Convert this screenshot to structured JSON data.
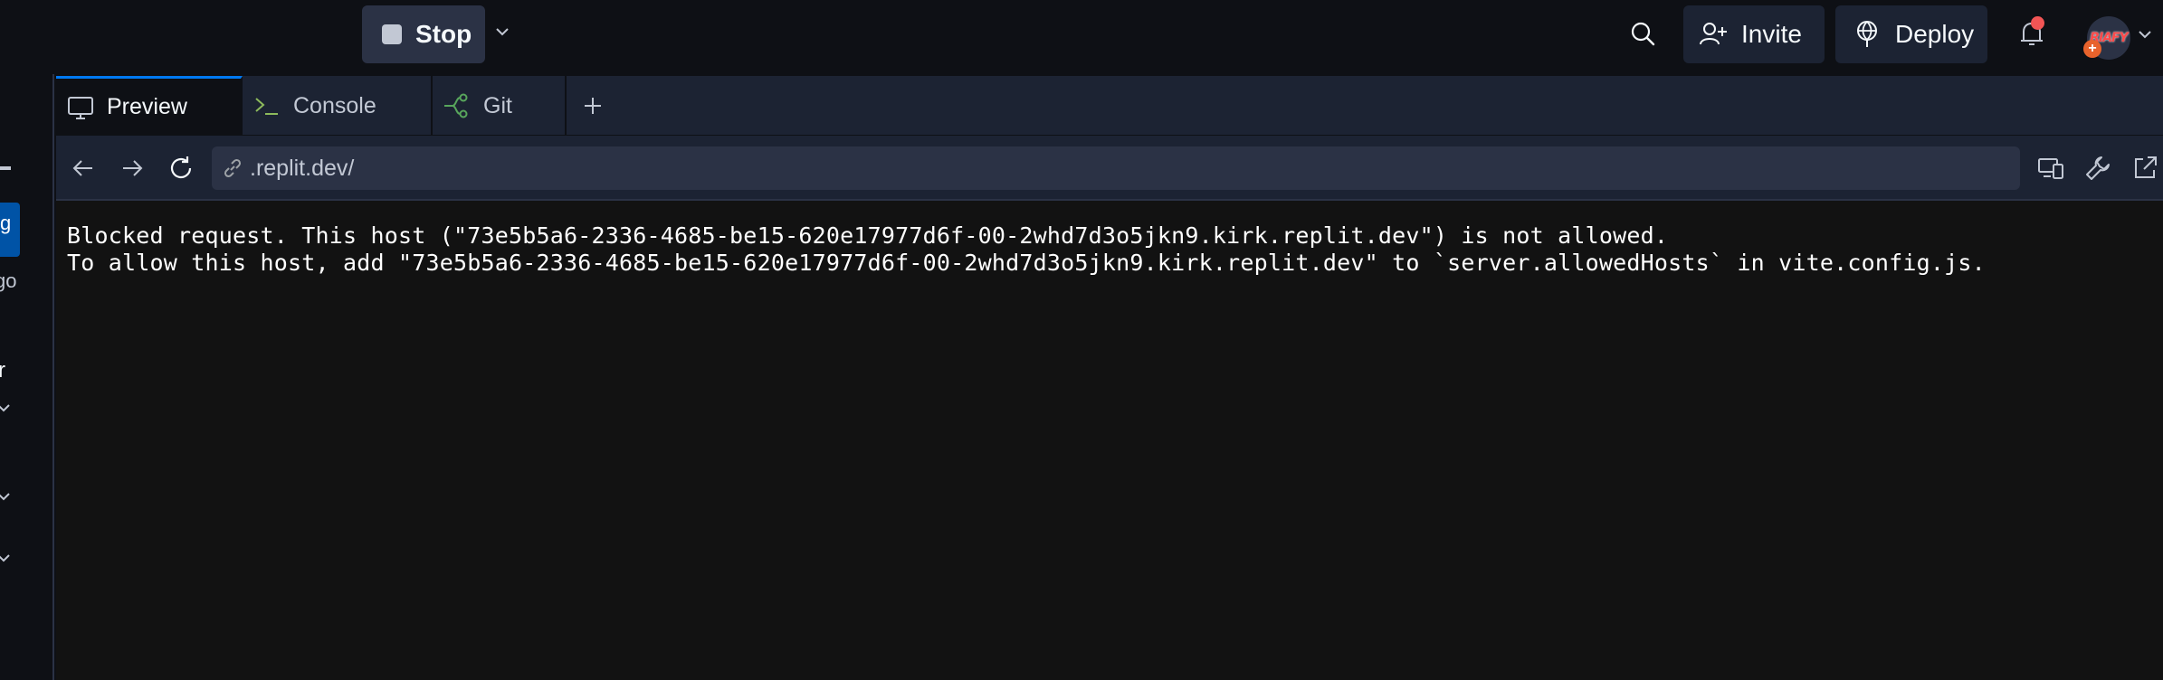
{
  "topbar": {
    "stop_label": "Stop",
    "invite_label": "Invite",
    "deploy_label": "Deploy",
    "avatar_text": "RIAFY",
    "notification_dot_color": "#f25555"
  },
  "left_sliver": {
    "fragments": [
      "g",
      "go",
      "r"
    ]
  },
  "tabs": [
    {
      "label": "Preview",
      "icon": "monitor-icon",
      "active": true
    },
    {
      "label": "Console",
      "icon": "terminal-icon",
      "active": false
    },
    {
      "label": "Git",
      "icon": "git-icon",
      "active": false
    }
  ],
  "browser": {
    "url": ".replit.dev/"
  },
  "content": {
    "line1": "Blocked request. This host (\"73e5b5a6-2336-4685-be15-620e17977d6f-00-2whd7d3o5jkn9.kirk.replit.dev\") is not allowed.",
    "line2": "To allow this host, add \"73e5b5a6-2336-4685-be15-620e17977d6f-00-2whd7d3o5jkn9.kirk.replit.dev\" to `server.allowedHosts` in vite.config.js."
  },
  "colors": {
    "accent": "#0079f2",
    "background": "#0e1015",
    "surface": "#1c2333",
    "git_green": "#58a65c",
    "console_green": "#8dba5c"
  }
}
